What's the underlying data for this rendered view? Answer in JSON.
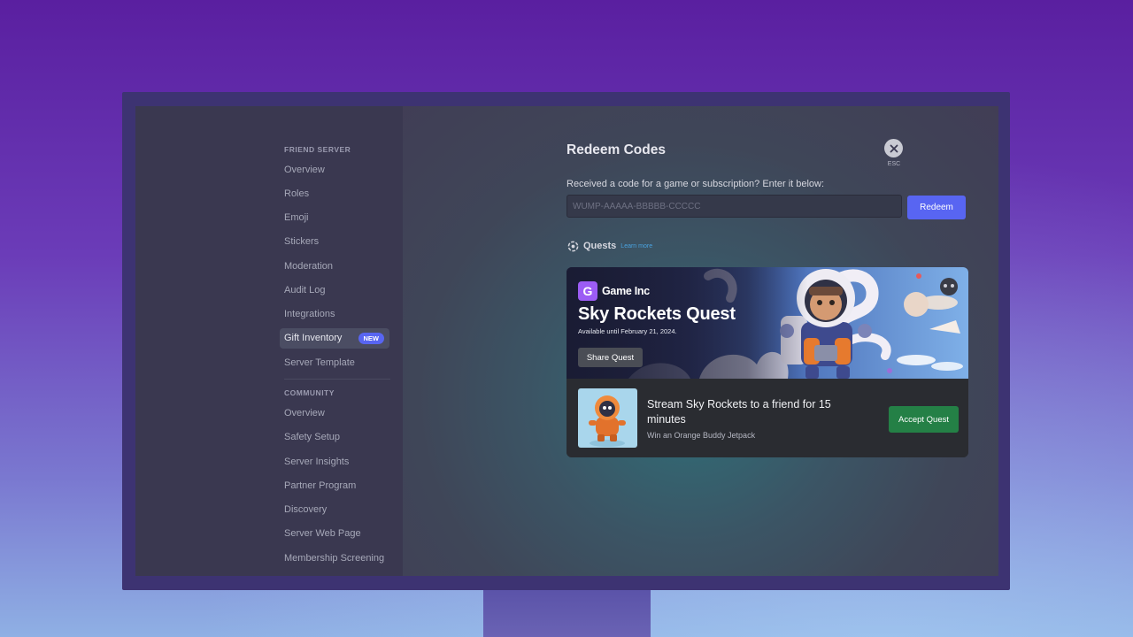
{
  "sidebar": {
    "sections": [
      {
        "header": "FRIEND SERVER",
        "items": [
          {
            "label": "Overview"
          },
          {
            "label": "Roles"
          },
          {
            "label": "Emoji"
          },
          {
            "label": "Stickers"
          },
          {
            "label": "Moderation"
          },
          {
            "label": "Audit Log"
          },
          {
            "label": "Integrations"
          },
          {
            "label": "Gift Inventory",
            "badge": "NEW",
            "active": true
          },
          {
            "label": "Server Template"
          }
        ]
      },
      {
        "header": "COMMUNITY",
        "items": [
          {
            "label": "Overview"
          },
          {
            "label": "Safety Setup"
          },
          {
            "label": "Server Insights"
          },
          {
            "label": "Partner Program"
          },
          {
            "label": "Discovery"
          },
          {
            "label": "Server Web Page"
          },
          {
            "label": "Membership Screening"
          }
        ]
      }
    ]
  },
  "main": {
    "title": "Redeem Codes",
    "close_label": "ESC",
    "prompt": "Received a code for a game or subscription? Enter it below:",
    "code_input": {
      "placeholder": "WUMP-AAAAA-BBBBB-CCCCC",
      "value": ""
    },
    "redeem_label": "Redeem",
    "quests": {
      "label": "Quests",
      "learn_more": "Learn more"
    }
  },
  "quest_card": {
    "brand": "Game Inc",
    "title": "Sky Rockets Quest",
    "availability": "Available until February 21, 2024.",
    "share_label": "Share Quest",
    "task": "Stream Sky Rockets to a friend for 15 minutes",
    "reward": "Win an Orange Buddy Jetpack",
    "accept_label": "Accept Quest"
  },
  "colors": {
    "accent": "#5865f2",
    "accept": "#248046",
    "brand_logo": "#9c5cf4",
    "link": "#4aa3e0"
  },
  "icons": [
    "close-icon",
    "quests-icon",
    "game-inc-logo-icon",
    "astronaut-hero-image",
    "orange-buddy-thumbnail"
  ]
}
